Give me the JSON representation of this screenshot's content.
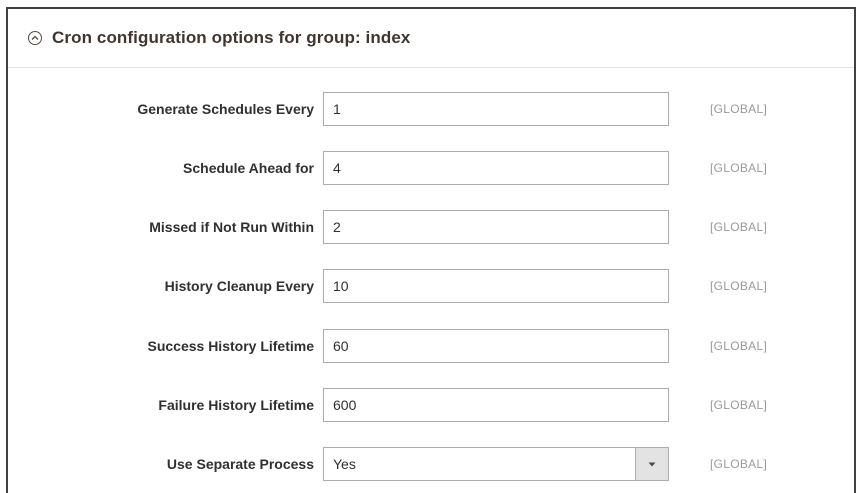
{
  "section": {
    "title": "Cron configuration options for group: index"
  },
  "fields": [
    {
      "label": "Generate Schedules Every",
      "value": "1",
      "scope": "[GLOBAL]"
    },
    {
      "label": "Schedule Ahead for",
      "value": "4",
      "scope": "[GLOBAL]"
    },
    {
      "label": "Missed if Not Run Within",
      "value": "2",
      "scope": "[GLOBAL]"
    },
    {
      "label": "History Cleanup Every",
      "value": "10",
      "scope": "[GLOBAL]"
    },
    {
      "label": "Success History Lifetime",
      "value": "60",
      "scope": "[GLOBAL]"
    },
    {
      "label": "Failure History Lifetime",
      "value": "600",
      "scope": "[GLOBAL]"
    },
    {
      "label": "Use Separate Process",
      "value": "Yes",
      "scope": "[GLOBAL]"
    }
  ],
  "icons": {
    "section_toggle": "chevron-up-circle-icon",
    "select_arrow": "caret-down-icon"
  },
  "colors": {
    "title": "#41362f",
    "label": "#303030",
    "scope": "#999999",
    "input_border": "#adadad",
    "select_button": "#e3e3e3"
  }
}
